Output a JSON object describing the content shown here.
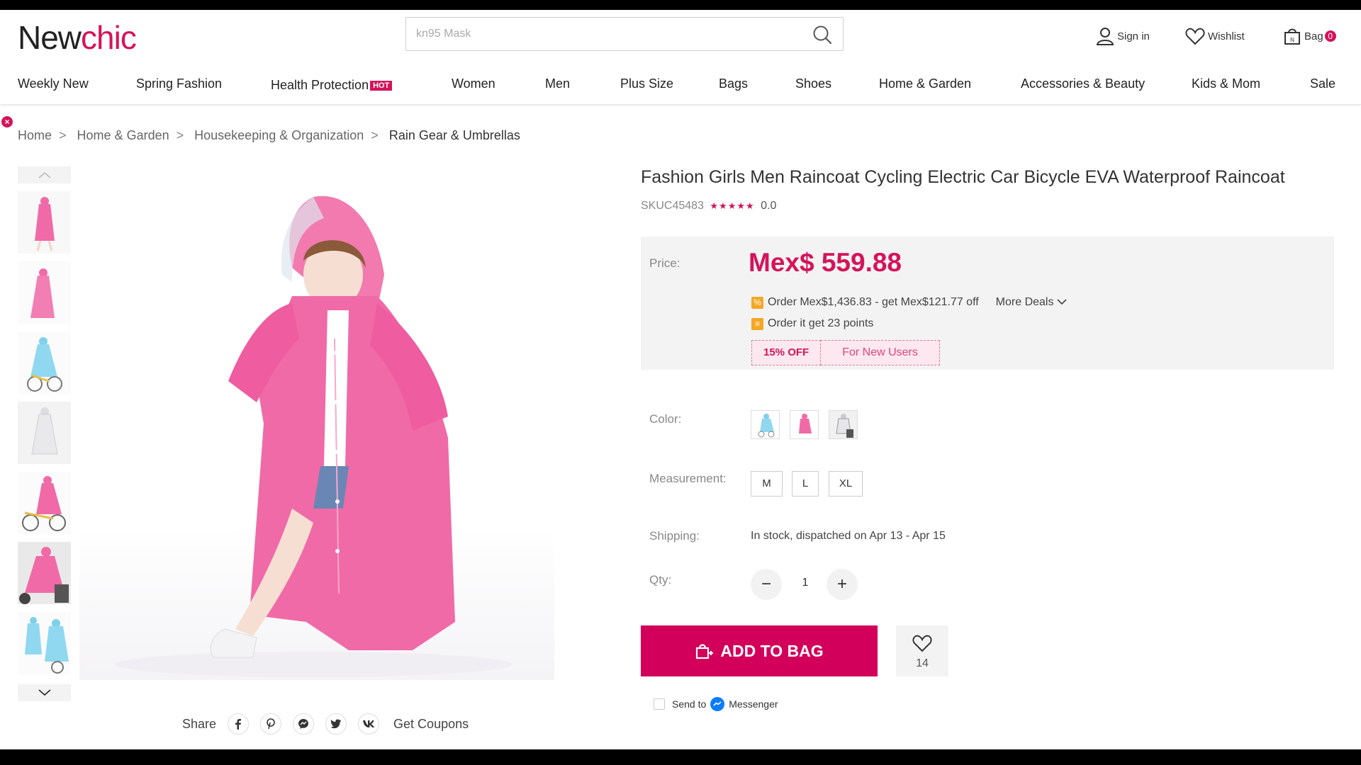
{
  "logo": {
    "part1": "New",
    "part2": "chic"
  },
  "search": {
    "placeholder": "kn95 Mask"
  },
  "header": {
    "signin": "Sign in",
    "wishlist": "Wishlist",
    "bag": "Bag",
    "bag_count": "0"
  },
  "nav": {
    "items": [
      "Weekly New",
      "Spring Fashion",
      "Health Protection",
      "Women",
      "Men",
      "Plus Size",
      "Bags",
      "Shoes",
      "Home & Garden",
      "Accessories & Beauty",
      "Kids & Mom",
      "Sale"
    ],
    "hot_badge": "HOT"
  },
  "close_glyph": "×",
  "breadcrumb": {
    "items": [
      "Home",
      "Home & Garden",
      "Housekeeping & Organization",
      "Rain Gear & Umbrellas"
    ],
    "separator": ">"
  },
  "product": {
    "title": "Fashion Girls Men Raincoat Cycling Electric Car Bicycle EVA Waterproof Raincoat",
    "sku": "SKUC45483",
    "stars": "★★★★★",
    "rating": "0.0",
    "price_label": "Price:",
    "price": "Mex$ 559.88",
    "deal1": "Order Mex$1,436.83 - get Mex$121.77 off",
    "more_deals": "More Deals",
    "deal2": "Order it get 23 points",
    "coupon_off": "15% OFF",
    "coupon_users": "For New Users",
    "color_label": "Color:",
    "measurement_label": "Measurement:",
    "sizes": [
      "M",
      "L",
      "XL"
    ],
    "shipping_label": "Shipping:",
    "shipping": "In stock, dispatched on Apr 13 - Apr 15",
    "qty_label": "Qty:",
    "qty": "1",
    "qty_minus": "−",
    "qty_plus": "+",
    "add_to_bag": "ADD TO BAG",
    "wish_count": "14",
    "send_to": "Send to",
    "messenger": "Messenger"
  },
  "share": {
    "label": "Share",
    "coupons": "Get Coupons"
  },
  "colors": {
    "brand": "#d4145a",
    "button": "#d2005a",
    "raincoat_pink": "#f06aa7",
    "raincoat_blue": "#7fd0ec"
  },
  "icons": [
    "search-icon",
    "user-icon",
    "heart-icon",
    "bag-icon",
    "close-icon",
    "chevron-up-icon",
    "chevron-down-icon",
    "facebook-icon",
    "pinterest-icon",
    "messenger-icon",
    "twitter-icon",
    "vk-icon",
    "percent-icon",
    "coin-icon",
    "cart-icon",
    "messenger-logo-icon"
  ]
}
